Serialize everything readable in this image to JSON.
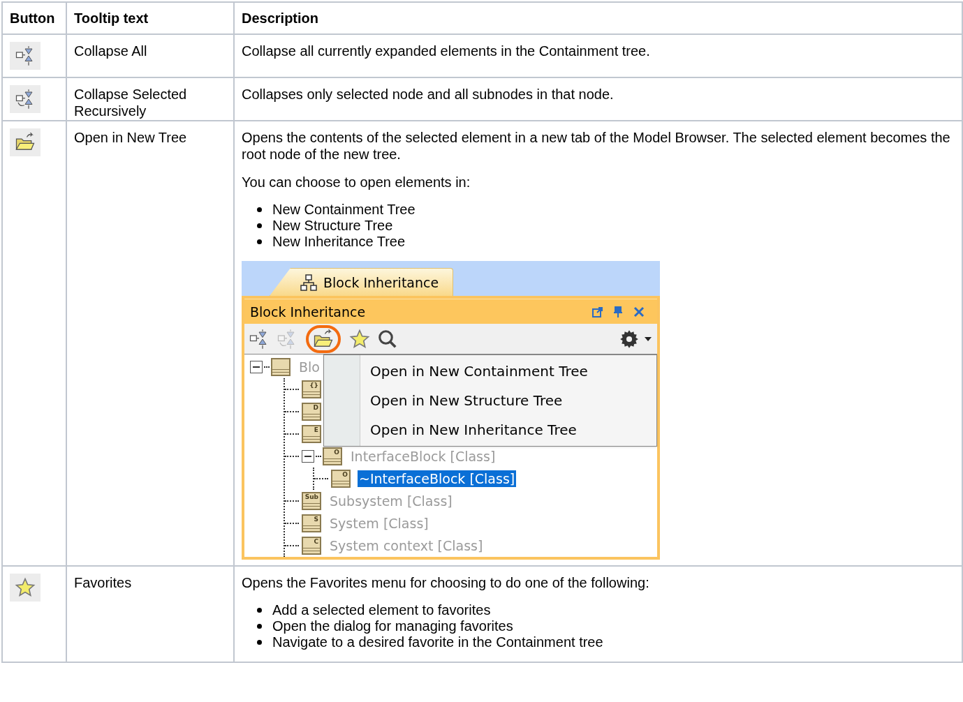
{
  "table": {
    "columns": [
      "Button",
      "Tooltip text",
      "Description"
    ],
    "rows": [
      {
        "button": {
          "kind": "collapse_all"
        },
        "tooltip": "Collapse All",
        "description": [
          {
            "kind": "paragraph",
            "text": "Collapse all currently expanded elements in the Containment tree."
          }
        ]
      },
      {
        "button": {
          "kind": "collapse_selected"
        },
        "tooltip": "Collapse Selected Recursively",
        "description": [
          {
            "kind": "paragraph",
            "text": "Collapses only selected node and all subnodes in that node."
          }
        ]
      },
      {
        "button": {
          "kind": "open_tree"
        },
        "tooltip": "Open in New Tree",
        "description": [
          {
            "kind": "paragraph",
            "text": "Opens the contents of the selected element in a new tab of the Model Browser. The selected element becomes the root node of the new tree."
          },
          {
            "kind": "paragraph",
            "text": "You can choose to open elements in:"
          },
          {
            "kind": "list",
            "items": [
              "New Containment Tree",
              "New Structure Tree",
              "New Inheritance Tree"
            ]
          },
          {
            "kind": "screenshot",
            "tab": "Block Inheritance",
            "panel_title": "Block Inheritance",
            "toolbar": [
              {
                "kind": "collapse_all",
                "disabled": false,
                "highlighted": false
              },
              {
                "kind": "collapse_selected",
                "disabled": true,
                "highlighted": false
              },
              {
                "kind": "open_tree",
                "disabled": false,
                "highlighted": true
              },
              {
                "kind": "star",
                "disabled": false,
                "highlighted": false
              },
              {
                "kind": "search",
                "disabled": false,
                "highlighted": false
              }
            ],
            "tree": {
              "label": "Blo",
              "expanded": true,
              "selected": false,
              "children": [
                {
                  "icon": "{}",
                  "selected": false
                },
                {
                  "icon": "D",
                  "selected": false
                },
                {
                  "icon": "E",
                  "selected": false
                },
                {
                  "icon": "O",
                  "label": "InterfaceBlock [Class]",
                  "expanded": true,
                  "selected": false,
                  "children": [
                    {
                      "icon": "O",
                      "label": "~InterfaceBlock [Class]",
                      "selected": true
                    }
                  ]
                },
                {
                  "icon": "Sub",
                  "label": "Subsystem [Class]",
                  "selected": false
                },
                {
                  "icon": "S",
                  "label": "System [Class]",
                  "selected": false
                },
                {
                  "icon": "C",
                  "label": "System context [Class]",
                  "selected": false
                }
              ]
            },
            "menu": [
              "Open in New Containment Tree",
              "Open in New Structure Tree",
              "Open in New Inheritance Tree"
            ]
          }
        ]
      },
      {
        "button": {
          "kind": "star"
        },
        "tooltip": "Favorites",
        "description": [
          {
            "kind": "paragraph",
            "text": "Opens the Favorites menu for choosing to do one of the following:"
          },
          {
            "kind": "list",
            "items": [
              "Add a selected element to favorites",
              "Open the dialog for managing favorites",
              "Navigate to a desired favorite in the Containment tree"
            ]
          }
        ]
      }
    ]
  }
}
